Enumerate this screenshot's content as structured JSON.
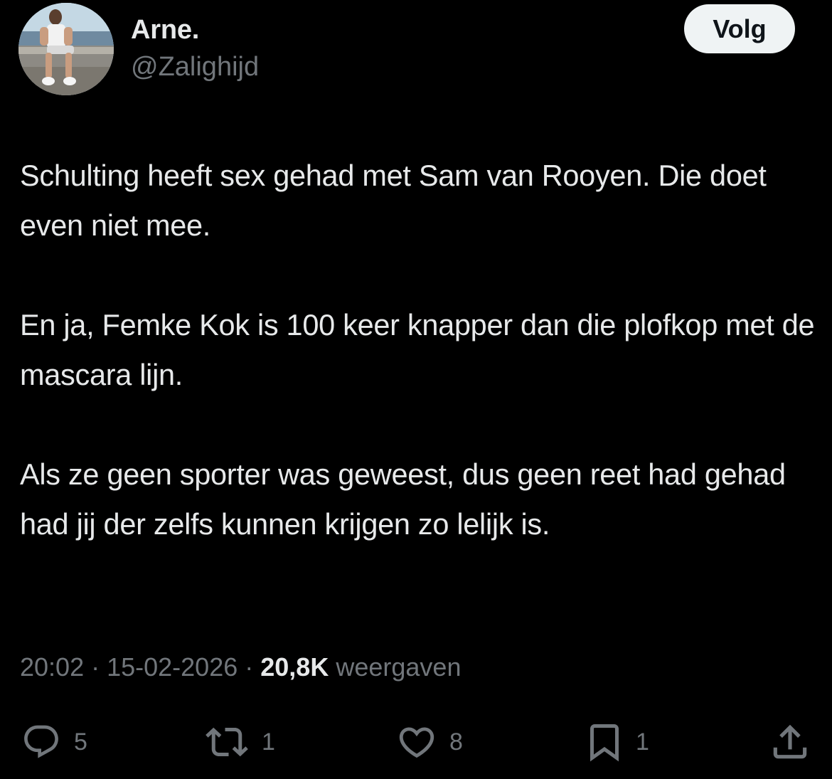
{
  "author": {
    "display_name": "Arne.",
    "handle": "@Zalighijd"
  },
  "follow_button": {
    "label": "Volg"
  },
  "tweet": {
    "paragraphs": [
      "Schulting heeft sex gehad met Sam van Rooyen. Die doet even niet mee.",
      "En ja, Femke Kok is 100 keer knapper dan die plofkop met de mascara lijn.",
      "Als ze geen sporter was geweest, dus geen reet had gehad had jij der zelfs kunnen krijgen zo lelijk is."
    ]
  },
  "meta": {
    "time": "20:02",
    "separator": " · ",
    "date": "15-02-2026",
    "views_count": "20,8K",
    "views_label": "weergaven"
  },
  "actions": {
    "replies": "5",
    "reposts": "1",
    "likes": "8",
    "bookmarks": "1"
  },
  "icons": {
    "reply": "speech-bubble-icon",
    "repost": "repost-arrows-icon",
    "like": "heart-icon",
    "bookmark": "bookmark-icon",
    "share": "share-upload-icon"
  },
  "colors": {
    "background": "#000000",
    "primary_text": "#e7e9ea",
    "secondary_text": "#71767b",
    "follow_button_bg": "#eff3f4",
    "follow_button_text": "#0f1419"
  }
}
